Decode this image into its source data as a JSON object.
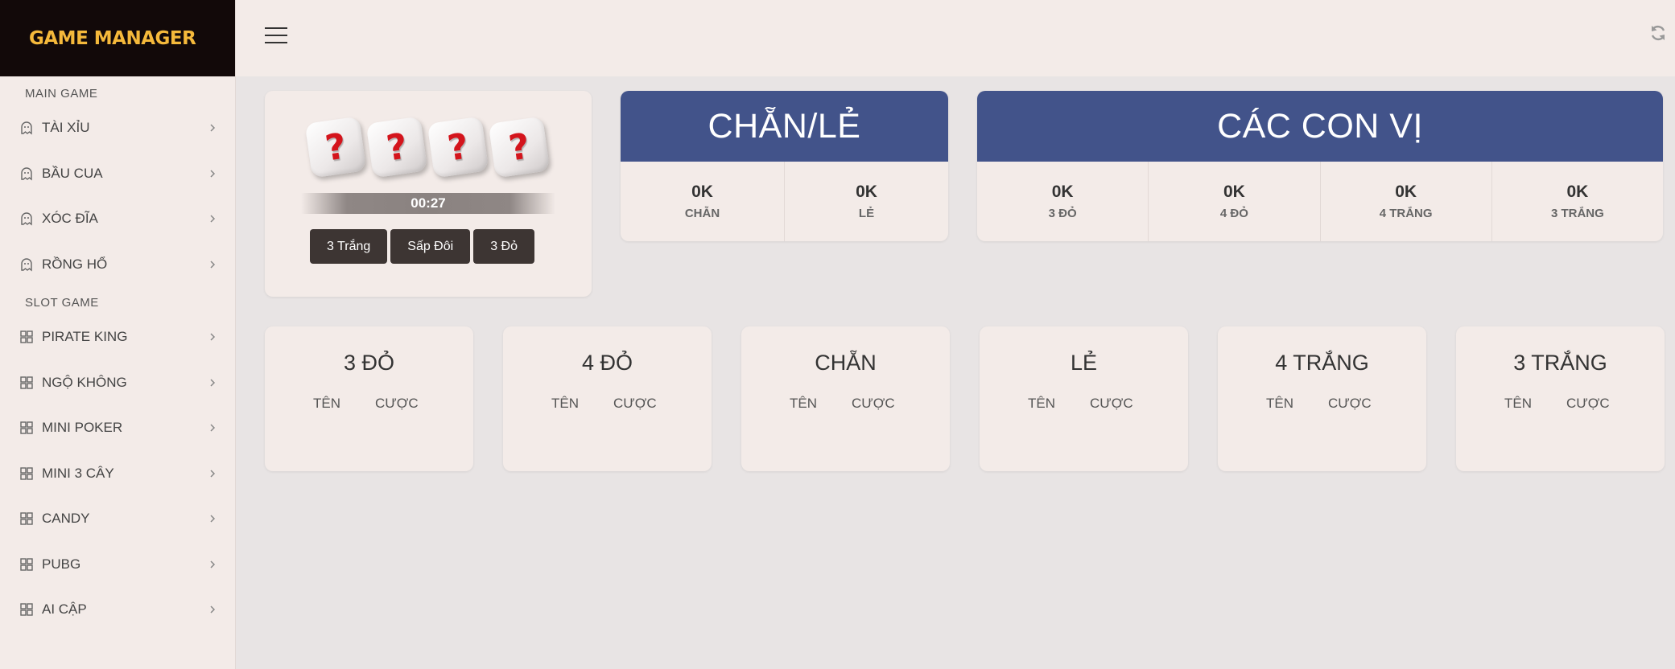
{
  "brand": "GAME MANAGER",
  "sidebar": {
    "sections": [
      {
        "label": "MAIN GAME",
        "items": [
          {
            "label": "TÀI XỈU",
            "icon": "ghost-icon"
          },
          {
            "label": "BẦU CUA",
            "icon": "ghost-icon"
          },
          {
            "label": "XÓC ĐĨA",
            "icon": "ghost-icon"
          },
          {
            "label": "RỒNG HỔ",
            "icon": "ghost-icon"
          }
        ]
      },
      {
        "label": "SLOT GAME",
        "items": [
          {
            "label": "PIRATE KING",
            "icon": "grid-icon"
          },
          {
            "label": "NGỘ KHÔNG",
            "icon": "grid-icon"
          },
          {
            "label": "MINI POKER",
            "icon": "grid-icon"
          },
          {
            "label": "MINI 3 CÂY",
            "icon": "grid-icon"
          },
          {
            "label": "CANDY",
            "icon": "grid-icon"
          },
          {
            "label": "PUBG",
            "icon": "grid-icon"
          },
          {
            "label": "AI CẬP",
            "icon": "grid-icon"
          }
        ]
      }
    ]
  },
  "dice": {
    "faces": [
      "?",
      "?",
      "?",
      "?"
    ],
    "timer": "00:27",
    "buttons": [
      "3 Trắng",
      "Sấp Đôi",
      "3 Đỏ"
    ]
  },
  "chanle": {
    "title": "CHẴN/LẺ",
    "cells": [
      {
        "value": "0K",
        "label": "CHẴN"
      },
      {
        "value": "0K",
        "label": "LẺ"
      }
    ]
  },
  "cacconvi": {
    "title": "CÁC CON VỊ",
    "cells": [
      {
        "value": "0K",
        "label": "3 ĐỎ"
      },
      {
        "value": "0K",
        "label": "4 ĐỎ"
      },
      {
        "value": "0K",
        "label": "4 TRẮNG"
      },
      {
        "value": "0K",
        "label": "3 TRẮNG"
      }
    ]
  },
  "results": [
    {
      "title": "3 ĐỎ",
      "col1": "TÊN",
      "col2": "CƯỢC"
    },
    {
      "title": "4 ĐỎ",
      "col1": "TÊN",
      "col2": "CƯỢC"
    },
    {
      "title": "CHẴN",
      "col1": "TÊN",
      "col2": "CƯỢC"
    },
    {
      "title": "LẺ",
      "col1": "TÊN",
      "col2": "CƯỢC"
    },
    {
      "title": "4 TRẮNG",
      "col1": "TÊN",
      "col2": "CƯỢC"
    },
    {
      "title": "3 TRẮNG",
      "col1": "TÊN",
      "col2": "CƯỢC"
    }
  ],
  "colors": {
    "brand": "#f5b93b",
    "panel_header": "#42538a",
    "die_mark": "#d4141c",
    "button_bg": "#3d3533"
  }
}
